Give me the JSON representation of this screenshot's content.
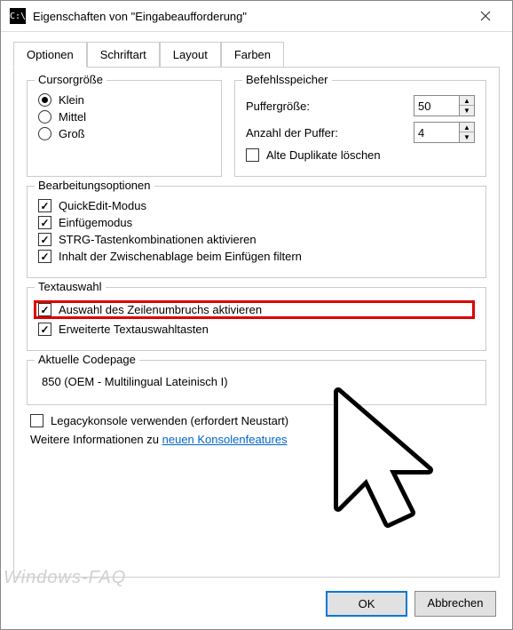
{
  "title": "Eigenschaften von \"Eingabeaufforderung\"",
  "tabs": {
    "options": "Optionen",
    "font": "Schriftart",
    "layout": "Layout",
    "colors": "Farben"
  },
  "cursor": {
    "legend": "Cursorgröße",
    "small": "Klein",
    "medium": "Mittel",
    "large": "Groß"
  },
  "buffer": {
    "legend": "Befehlsspeicher",
    "sizeLabel": "Puffergröße:",
    "sizeValue": "50",
    "countLabel": "Anzahl der Puffer:",
    "countValue": "4",
    "discard": "Alte Duplikate löschen"
  },
  "edit": {
    "legend": "Bearbeitungsoptionen",
    "quick": "QuickEdit-Modus",
    "insert": "Einfügemodus",
    "ctrl": "STRG-Tastenkombinationen aktivieren",
    "paste": "Inhalt der Zwischenablage beim Einfügen filtern"
  },
  "textsel": {
    "legend": "Textauswahl",
    "wrap": "Auswahl des Zeilenumbruchs aktivieren",
    "extended": "Erweiterte Textauswahltasten"
  },
  "codepage": {
    "legend": "Aktuelle Codepage",
    "value": "850  (OEM - Multilingual Lateinisch I)"
  },
  "legacy": "Legacykonsole verwenden (erfordert Neustart)",
  "infoPrefix": "Weitere Informationen zu ",
  "infoLink": "neuen Konsolenfeatures",
  "buttons": {
    "ok": "OK",
    "cancel": "Abbrechen"
  },
  "watermark": "Windows-FAQ"
}
